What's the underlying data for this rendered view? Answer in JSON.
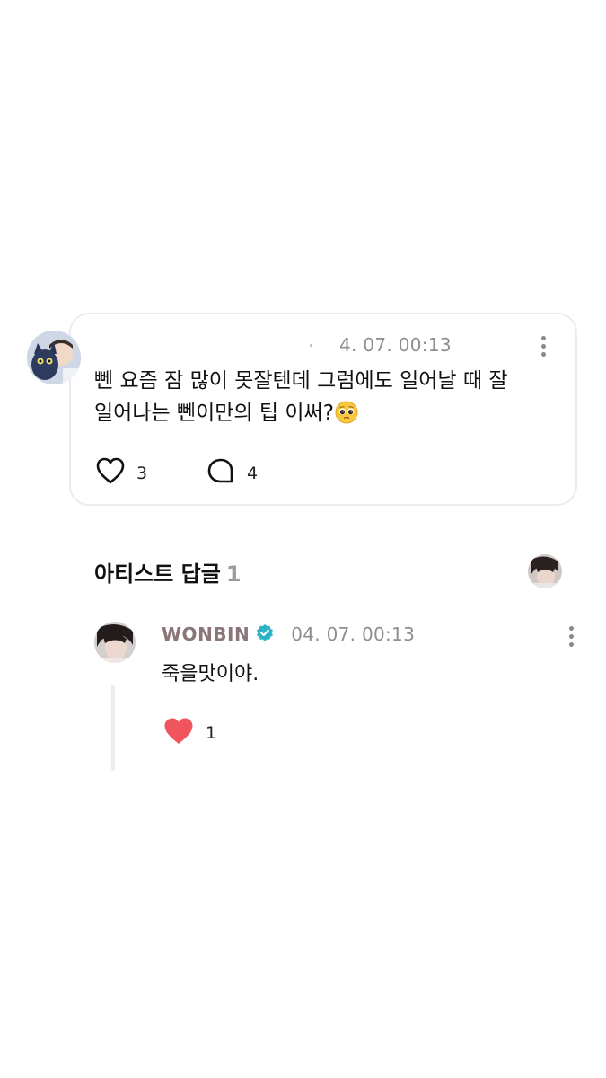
{
  "post": {
    "date": "4. 07. 00:13",
    "text_line1": "뻰 요즘 잠 많이 못잘텐데 그럼에도 일어날 때 잘",
    "text_line2": "일어나는 뻰이만의 팁 이써?",
    "emoji": "pleading-face-emoji",
    "like_count": "3",
    "comment_count": "4"
  },
  "section": {
    "title": "아티스트 답글",
    "count": "1"
  },
  "reply": {
    "author": "WONBIN",
    "verified": true,
    "date": "04. 07. 00:13",
    "text": "죽을맛이야.",
    "like_count": "1",
    "like_color": "#f0545c"
  },
  "colors": {
    "artist_name": "#8a7679",
    "verified_badge": "#2bb3c8",
    "card_border": "#ececec",
    "meta_text": "#8e8e8e"
  }
}
